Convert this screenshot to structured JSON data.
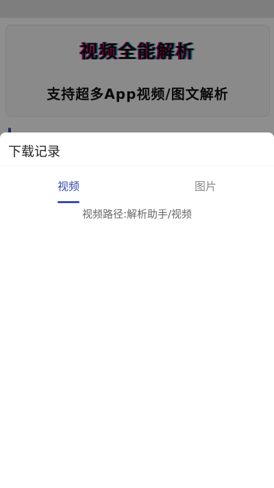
{
  "background": {
    "banner_title": "视频全能解析",
    "banner_subtitle": "支持超多App视频/图文解析"
  },
  "sheet": {
    "title": "下载记录",
    "tabs": [
      {
        "label": "视频",
        "active": true
      },
      {
        "label": "图片",
        "active": false
      }
    ],
    "path_text": "视频路径:解析助手/视频"
  },
  "colors": {
    "accent": "#3949ab",
    "overlay": "rgba(0,0,0,0.42)",
    "inactive_tab": "#888888"
  }
}
